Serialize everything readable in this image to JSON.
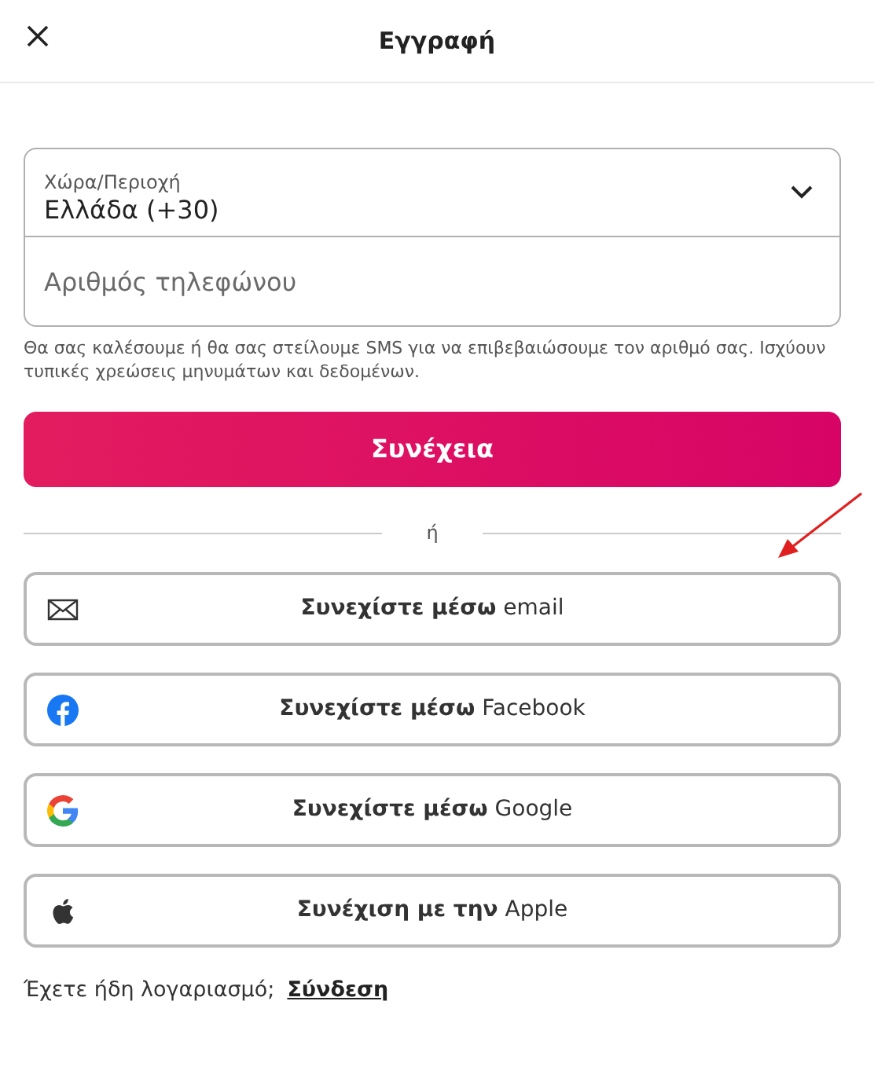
{
  "header": {
    "title": "Εγγραφή"
  },
  "country": {
    "label": "Χώρα/Περιοχή",
    "value": "Ελλάδα (+30)"
  },
  "phone": {
    "placeholder": "Αριθμός τηλεφώνου"
  },
  "hint": "Θα σας καλέσουμε ή θα σας στείλουμε SMS για να επιβεβαιώσουμε τον αριθμό σας. Ισχύουν τυπικές χρεώσεις μηνυμάτων και δεδομένων.",
  "continue_button": "Συνέχεια",
  "divider": "ή",
  "providers": [
    {
      "kind": "email",
      "label": "**Συνεχίστε μέσω** email"
    },
    {
      "kind": "facebook",
      "label": "**Συνεχίστε μέσω** Facebook"
    },
    {
      "kind": "google",
      "label": "**Συνεχίστε μέσω** Google"
    },
    {
      "kind": "apple",
      "label": "**Συνέχιση με την** Apple"
    }
  ],
  "footer": {
    "text": "Έχετε ήδη λογαριασμό;",
    "link": "Σύνδεση"
  },
  "annotation": {
    "kind": "arrow"
  }
}
